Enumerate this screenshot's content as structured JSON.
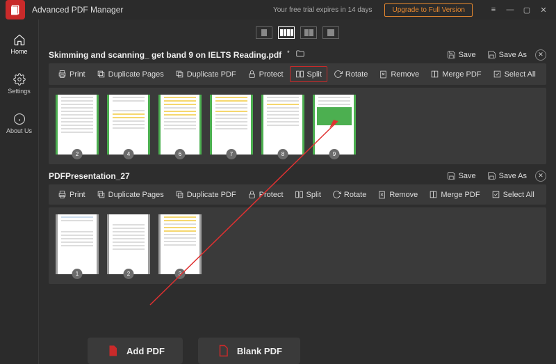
{
  "titlebar": {
    "app_name": "Advanced PDF Manager",
    "trial_text": "Your free trial expires in 14 days",
    "upgrade_label": "Upgrade to Full Version"
  },
  "sidebar": {
    "items": [
      {
        "label": "Home"
      },
      {
        "label": "Settings"
      },
      {
        "label": "About Us"
      }
    ]
  },
  "docs": [
    {
      "title": "Skimming and scanning_ get band 9 on IELTS Reading.pdf",
      "save": "Save",
      "saveas": "Save As",
      "toolbar": {
        "print": "Print",
        "dup_pages": "Duplicate Pages",
        "dup_pdf": "Duplicate PDF",
        "protect": "Protect",
        "split": "Split",
        "rotate": "Rotate",
        "remove": "Remove",
        "merge": "Merge PDF",
        "select_all": "Select All"
      },
      "pages": [
        "2",
        "4",
        "6",
        "7",
        "8",
        "9"
      ]
    },
    {
      "title": "PDFPresentation_27",
      "save": "Save",
      "saveas": "Save As",
      "toolbar": {
        "print": "Print",
        "dup_pages": "Duplicate Pages",
        "dup_pdf": "Duplicate PDF",
        "protect": "Protect",
        "split": "Split",
        "rotate": "Rotate",
        "remove": "Remove",
        "merge": "Merge PDF",
        "select_all": "Select All"
      },
      "pages": [
        "1",
        "2",
        "3"
      ]
    }
  ],
  "bottom": {
    "add_pdf": "Add PDF",
    "blank_pdf": "Blank PDF"
  }
}
